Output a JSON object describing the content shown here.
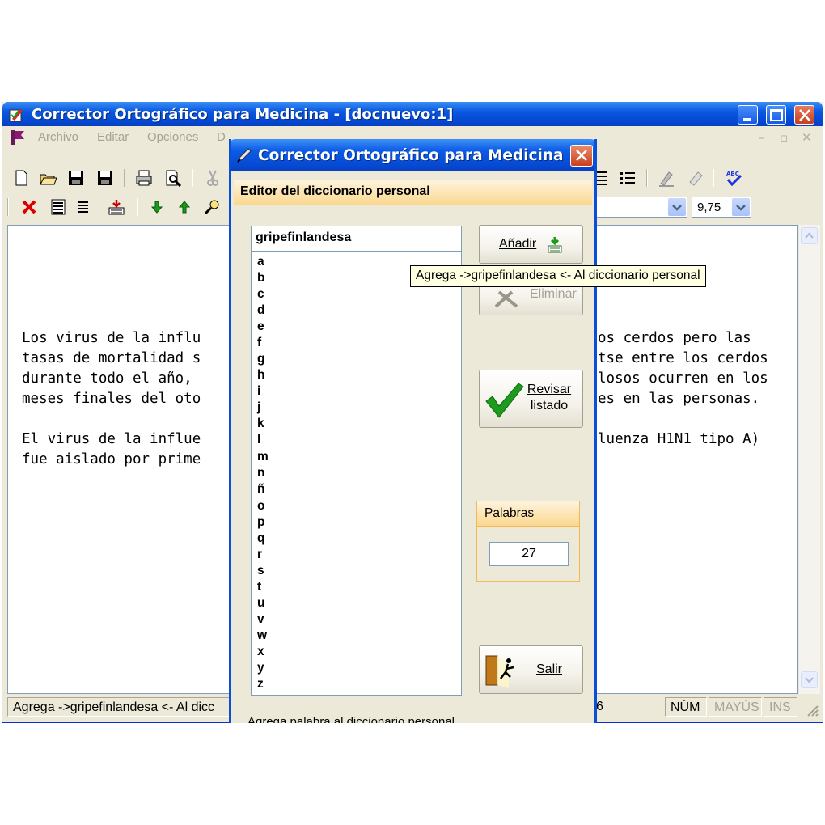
{
  "main_window": {
    "title": "Corrector Ortográfico para Medicina - [docnuevo:1]",
    "menu": [
      "Archivo",
      "Editar",
      "Opciones",
      "D"
    ],
    "font_size": "9,75",
    "editor_lines": [
      "Los virus de la influ",
      "tasas de mortalidad s",
      "durante todo el año, ",
      "meses finales del oto",
      "El virus de la influe",
      "fue aislado por prime"
    ],
    "editor_lines_right": [
      "os cerdos pero las",
      "tse entre los cerdos",
      "losos ocurren en los",
      "es en las personas.",
      "luenza H1N1 tipo A)"
    ],
    "status": {
      "message": "Agrega ->gripefinlandesa <- Al dicc",
      "num_fragment": "6",
      "num": "NÚM",
      "caps": "MAYÚS",
      "ins": "INS"
    }
  },
  "dialog": {
    "title": "Corrector Ortográfico para Medicina",
    "header": "Editor del diccionario personal",
    "word_value": "gripefinlandesa",
    "letters": [
      "a",
      "b",
      "c",
      "d",
      "e",
      "f",
      "g",
      "h",
      "i",
      "j",
      "k",
      "l",
      "m",
      "n",
      "ñ",
      "o",
      "p",
      "q",
      "r",
      "s",
      "t",
      "u",
      "v",
      "w",
      "x",
      "y",
      "z"
    ],
    "add_label": "Añadir",
    "delete_label": "Eliminar",
    "review_label_1": "Revisar",
    "review_label_2": "listado",
    "words_group_title": "Palabras",
    "words_count": "27",
    "exit_label": "Salir",
    "status_text": "Agrega palabra al diccionario personal"
  },
  "tooltip": "Agrega ->gripefinlandesa <- Al diccionario personal",
  "colors": {
    "titlebar_blue": "#0a58e0",
    "header_orange": "#fbd88f",
    "check_green": "#1e9a1e"
  }
}
